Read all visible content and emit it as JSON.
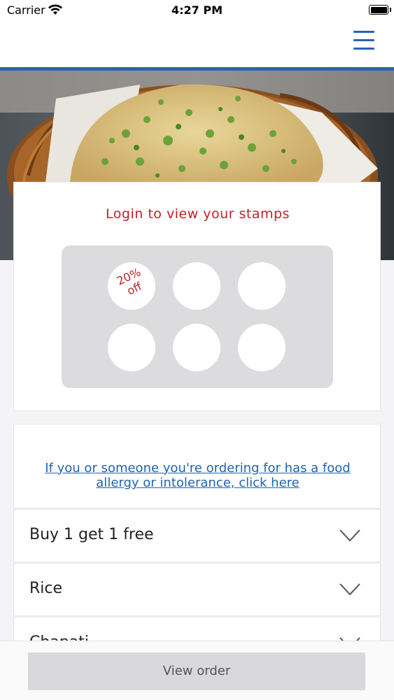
{
  "status_bar": {
    "carrier": "Carrier",
    "time": "4:27 PM"
  },
  "nav": {
    "menu_icon": "hamburger-menu-icon",
    "accent_color": "#2a63b0"
  },
  "stamps": {
    "login_prompt": "Login to view your stamps",
    "reward_label": "20%\noff",
    "total_slots": 6,
    "accent_color": "#c62027"
  },
  "allergy": {
    "link_text": "If you or someone you're ordering for has a food allergy or intolerance, click here"
  },
  "categories": [
    {
      "label": "Buy 1 get 1 free"
    },
    {
      "label": "Rice"
    },
    {
      "label": "Chapati"
    }
  ],
  "footer": {
    "view_order_label": "View order"
  }
}
